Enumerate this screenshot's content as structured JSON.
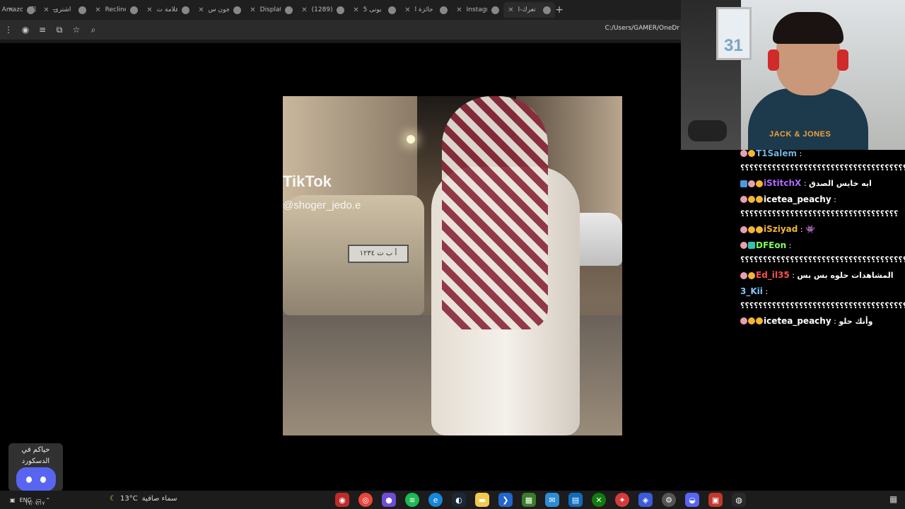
{
  "browser": {
    "tabs": [
      {
        "label": "تعرك-ا",
        "active": true
      },
      {
        "label": "Instagr"
      },
      {
        "label": "جائزة ا"
      },
      {
        "label": "يونى 5"
      },
      {
        "label": "(1289)"
      },
      {
        "label": "Displat"
      },
      {
        "label": "جون س"
      },
      {
        "label": "علامة ت"
      },
      {
        "label": "Recline"
      },
      {
        "label": "اشترى"
      },
      {
        "label": "Amazo"
      }
    ],
    "new_tab": "+",
    "address": "C:/Users/GAMER/OneDr"
  },
  "content": {
    "tiktok_logo": "TikTok",
    "tiktok_user": "@shoger_jedo.e",
    "plate_text": "أ ب ت ١٢٣٤"
  },
  "webcam": {
    "frame_number": "31",
    "shirt_brand": "JACK & JONES"
  },
  "chat": {
    "messages": [
      {
        "user": "T1Salem",
        "color": "#6fb7e8",
        "badges": [
          "pink",
          "gold"
        ],
        "text": "؟؟؟؟؟؟؟؟؟؟؟؟؟؟؟؟؟؟؟؟؟؟؟؟؟؟؟؟؟؟؟؟؟؟؟؟؟؟؟؟؟؟؟؟؟؟؟؟؟؟؟؟؟؟؟؟؟؟؟؟؟؟؟؟؟؟؟؟؟؟؟؟؟؟؟؟؟؟؟؟؟؟؟؟؟؟؟؟؟؟؟؟؟؟؟؟"
      },
      {
        "user": "iStitchX",
        "color": "#b266ff",
        "badges": [
          "blue",
          "pink",
          "gold"
        ],
        "text": "ايه خايس الصدق"
      },
      {
        "user": "icetea_peachy",
        "color": "#ffffff",
        "badges": [
          "pink",
          "gold",
          "gold"
        ],
        "text": "؟؟؟؟؟؟؟؟؟؟؟؟؟؟؟؟؟؟؟؟؟؟؟؟؟؟؟؟؟؟؟؟؟؟؟"
      },
      {
        "user": "iSziyad",
        "color": "#f2b632",
        "badges": [
          "pink",
          "gold",
          "gold"
        ],
        "text": "👾"
      },
      {
        "user": "DFEon",
        "color": "#7dff5a",
        "badges": [
          "pink",
          "teal"
        ],
        "text": "؟؟؟؟؟؟؟؟؟؟؟؟؟؟؟؟؟؟؟؟؟؟؟؟؟؟؟؟؟؟؟؟؟؟؟؟؟؟؟؟؟؟؟؟؟؟؟؟؟؟؟؟؟؟؟؟؟؟؟؟؟؟؟؟؟؟؟؟؟؟؟؟؟؟؟؟؟؟؟؟؟؟؟؟؟؟؟؟؟؟؟؟؟؟؟؟؟؟؟؟؟؟؟؟؟"
      },
      {
        "user": "Ed_il35",
        "color": "#ff4d4d",
        "badges": [
          "pink",
          "gold"
        ],
        "text": "المشاهدات حلوه بس بس"
      },
      {
        "user": "3_Kii",
        "color": "#7ec8ff",
        "badges": [],
        "text": "؟؟؟؟؟؟؟؟؟؟؟؟؟؟؟؟؟؟؟؟؟؟؟؟؟؟؟؟؟؟؟؟؟؟؟؟؟؟؟؟؟؟؟؟؟؟؟"
      },
      {
        "user": "icetea_peachy",
        "color": "#ffffff",
        "badges": [
          "pink",
          "gold",
          "gold"
        ],
        "text": "وأنك حلو"
      }
    ]
  },
  "discord": {
    "line1": "حياكم في",
    "line2": "الدسكورد"
  },
  "taskbar": {
    "lang": "ENG",
    "date": "٢٧/٠٧/١٧",
    "temperature": "13°C",
    "weather_text": "سماء صافية"
  }
}
